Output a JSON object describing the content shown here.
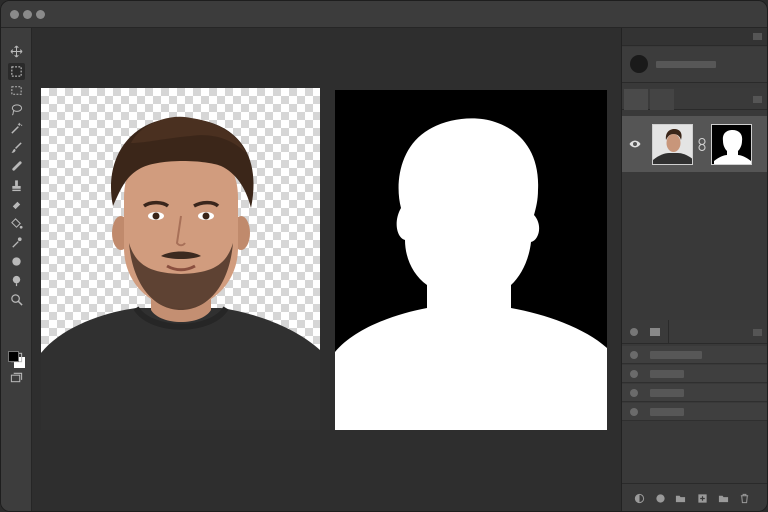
{
  "window": {
    "traffic_lights": [
      "close",
      "minimize",
      "zoom"
    ]
  },
  "toolbar": {
    "tools": [
      {
        "icon": "move-icon"
      },
      {
        "icon": "marquee-icon",
        "active": true
      },
      {
        "icon": "marquee-alt-icon"
      },
      {
        "icon": "lasso-icon"
      },
      {
        "icon": "magic-wand-icon"
      },
      {
        "icon": "brush-icon"
      },
      {
        "icon": "healing-icon"
      },
      {
        "icon": "clone-stamp-icon"
      },
      {
        "icon": "eraser-icon"
      },
      {
        "icon": "paint-bucket-icon"
      },
      {
        "icon": "eyedropper-icon"
      },
      {
        "icon": "blur-icon"
      },
      {
        "icon": "dodge-icon"
      },
      {
        "icon": "zoom-icon"
      }
    ],
    "colors": {
      "foreground": "#000000",
      "background": "#ffffff"
    }
  },
  "canvas": {
    "documents": [
      {
        "name": "photo",
        "content": "portrait-with-transparent-background"
      },
      {
        "name": "mask",
        "content": "silhouette-mask"
      }
    ]
  },
  "panels": {
    "accent": "#555555",
    "layers": {
      "visible": true,
      "linked": true
    },
    "list_rows": 4
  }
}
